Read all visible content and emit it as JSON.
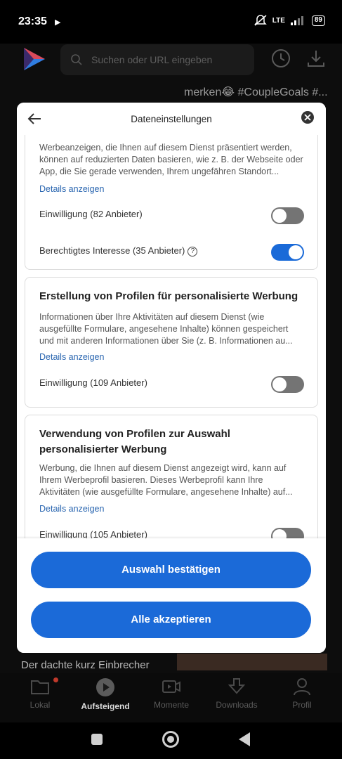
{
  "status_bar": {
    "time": "23:35",
    "network": "LTE",
    "battery": "89"
  },
  "app_header": {
    "search_placeholder": "Suchen oder URL eingeben",
    "background_snippet": "merken😂 #CoupleGoals #..."
  },
  "dialog": {
    "title": "Dateneinstellungen",
    "card1": {
      "desc": "Werbeanzeigen, die Ihnen auf diesem Dienst präsentiert werden, können auf reduzierten Daten basieren, wie z. B. der Webseite oder App, die Sie gerade verwenden, Ihrem ungefähren Standort...",
      "details": "Details anzeigen",
      "consent_label": "Einwilligung (82 Anbieter)",
      "consent_on": false,
      "legit_label": "Berechtigtes Interesse (35 Anbieter)",
      "legit_help": "?",
      "legit_on": true
    },
    "card2": {
      "title": "Erstellung von Profilen für personalisierte Werbung",
      "desc": "Informationen über Ihre Aktivitäten auf diesem Dienst (wie ausgefüllte Formulare, angesehene Inhalte) können gespeichert und mit anderen Informationen über Sie (z. B. Informationen au...",
      "details": "Details anzeigen",
      "consent_label": "Einwilligung (109 Anbieter)",
      "consent_on": false
    },
    "card3": {
      "title": "Verwendung von Profilen zur Auswahl personalisierter Werbung",
      "desc": "Werbung, die Ihnen auf diesem Dienst angezeigt wird, kann auf Ihrem Werbeprofil basieren. Dieses Werbeprofil kann Ihre Aktivitäten (wie ausgefüllte Formulare, angesehene Inhalte) auf...",
      "details": "Details anzeigen",
      "consent_label": "Einwilligung (105 Anbieter)",
      "consent_on": false
    },
    "confirm_button": "Auswahl bestätigen",
    "accept_all_button": "Alle akzeptieren"
  },
  "background_feed": {
    "caption": "Der dachte kurz Einbrecher"
  },
  "bottom_nav": {
    "items": [
      {
        "label": "Lokal",
        "icon": "folder-icon"
      },
      {
        "label": "Aufsteigend",
        "icon": "play-circle-icon"
      },
      {
        "label": "Momente",
        "icon": "video-icon"
      },
      {
        "label": "Downloads",
        "icon": "download-icon"
      },
      {
        "label": "Profil",
        "icon": "profile-icon"
      }
    ],
    "active": "Aufsteigend"
  },
  "colors": {
    "accent": "#1b6ad8",
    "link": "#2a66b0",
    "toggle_off": "#747474"
  }
}
